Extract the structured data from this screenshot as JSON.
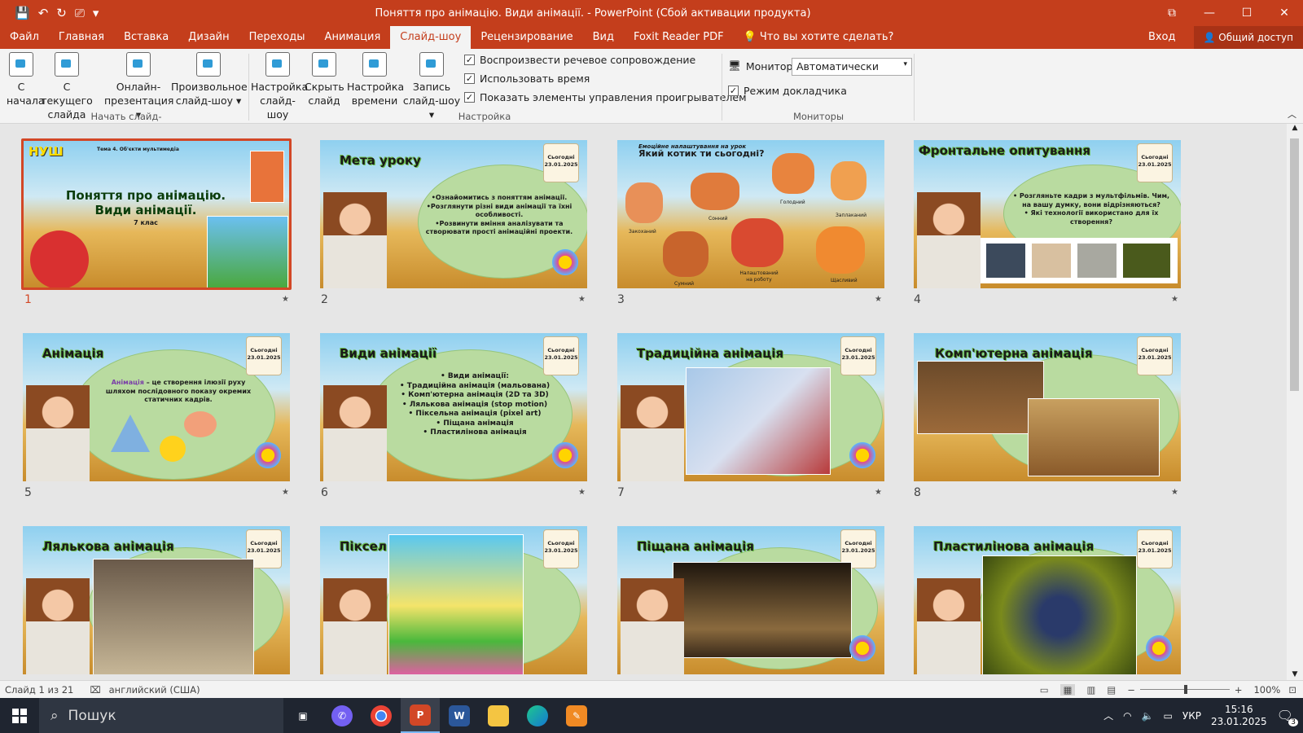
{
  "window": {
    "title": "Поняття про анімацію. Види анімації. - PowerPoint (Сбой активации продукта)",
    "qat": [
      "💾",
      "↶",
      "↻",
      "⎚",
      "▾"
    ]
  },
  "tabs": [
    "Файл",
    "Главная",
    "Вставка",
    "Дизайн",
    "Переходы",
    "Анимация",
    "Слайд-шоу",
    "Рецензирование",
    "Вид",
    "Foxit Reader PDF"
  ],
  "tell_me": "Что вы хотите сделать?",
  "signin": "Вход",
  "share": "Общий доступ",
  "ribbon": {
    "buttons": [
      {
        "l1": "С",
        "l2": "начала"
      },
      {
        "l1": "С текущего",
        "l2": "слайда"
      },
      {
        "l1": "Онлайн-",
        "l2": "презентация ▾"
      },
      {
        "l1": "Произвольное",
        "l2": "слайд-шоу ▾"
      },
      {
        "l1": "Настройка",
        "l2": "слайд-шоу"
      },
      {
        "l1": "Скрыть",
        "l2": "слайд"
      },
      {
        "l1": "Настройка",
        "l2": "времени"
      },
      {
        "l1": "Запись",
        "l2": "слайд-шоу ▾"
      }
    ],
    "checks": [
      "Воспроизвести речевое сопровождение",
      "Использовать время",
      "Показать элементы управления проигрывателем"
    ],
    "monitor_label": "Монитор:",
    "monitor_value": "Автоматически",
    "presenter_mode": "Режим докладчика",
    "groups": [
      "Начать слайд-шоу",
      "Настройка",
      "Мониторы"
    ]
  },
  "slides": [
    {
      "n": "1",
      "title": "НУШ",
      "topic": "Тема 4. Об'єкти мультимедіа",
      "h1": "Поняття про анімацію.",
      "h2": "Види анімації.",
      "sub": "7 клас"
    },
    {
      "n": "2",
      "title": "Мета уроку",
      "date_l1": "Сьогодні",
      "date": "23.01.2025",
      "body": [
        "•Ознайомитись з поняттям анімації.",
        "•Розглянути різні види анімації та їхні особливості.",
        "•Розвинути вміння аналізувати та створювати прості анімаційні проекти."
      ]
    },
    {
      "n": "3",
      "kicker": "Емоційне налаштування на урок",
      "title": "Який котик ти сьогодні?",
      "cats": [
        "Сонний",
        "Голодний",
        "Заплаканий",
        "Закоханий",
        "Сумний",
        "Налаштований на роботу",
        "Щасливий"
      ]
    },
    {
      "n": "4",
      "title": "Фронтальне опитування",
      "date_l1": "Сьогодні",
      "date": "23.01.2025",
      "body": [
        "• Розгляньте кадри з мультфільмів. Чим, на вашу думку, вони відрізняються?",
        "• Які технології використано для їх створення?"
      ]
    },
    {
      "n": "5",
      "title": "Анімація",
      "date_l1": "Сьогодні",
      "date": "23.01.2025",
      "term": "Анімація",
      "def": " – це створення ілюзії руху шляхом послідовного показу окремих статичних кадрів."
    },
    {
      "n": "6",
      "title": "Види анімації",
      "date_l1": "Сьогодні",
      "date": "23.01.2025",
      "body": [
        "•  Види анімації:",
        "• Традиційна анімація (мальована)",
        "• Комп'ютерна анімація (2D та 3D)",
        "• Лялькова анімація (stop motion)",
        "• Піксельна анімація (pixel art)",
        "• Піщана анімація",
        "• Пластилінова анімація"
      ]
    },
    {
      "n": "7",
      "title": "Традиційна анімація",
      "date_l1": "Сьогодні",
      "date": "23.01.2025"
    },
    {
      "n": "8",
      "title": "Комп'ютерна анімація",
      "date_l1": "Сьогодні",
      "date": "23.01.2025"
    },
    {
      "n": "9",
      "title": "Лялькова анімація",
      "date_l1": "Сьогодні",
      "date": "23.01.2025"
    },
    {
      "n": "10",
      "title": "Піксел",
      "date_l1": "Сьогодні",
      "date": "23.01.2025"
    },
    {
      "n": "11",
      "title": "Піщана анімація",
      "date_l1": "Сьогодні",
      "date": "23.01.2025"
    },
    {
      "n": "12",
      "title": "Пластилінова анімація",
      "date_l1": "Сьогодні",
      "date": "23.01.2025"
    }
  ],
  "status": {
    "slide": "Слайд 1 из 21",
    "language": "английский (США)",
    "zoom": "100%"
  },
  "taskbar": {
    "search": "Пошук",
    "lang": "УКР",
    "time": "15:16",
    "date": "23.01.2025",
    "notif": "3"
  },
  "colors": {
    "accent": "#c43e1c",
    "selected": "#d24726"
  }
}
